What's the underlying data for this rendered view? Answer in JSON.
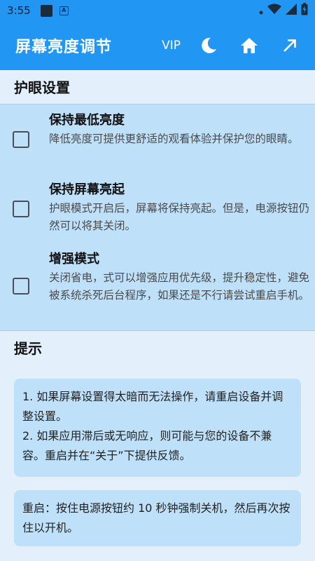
{
  "status_bar": {
    "time": "3:55",
    "notif_letter": "A"
  },
  "app_bar": {
    "title": "屏幕亮度调节",
    "vip_label": "VIP",
    "icons": [
      "moon-icon",
      "home-icon",
      "arrow-up-right-icon"
    ]
  },
  "eye_care": {
    "header": "护眼设置",
    "items": [
      {
        "title": "保持最低亮度",
        "description": "降低亮度可提供更舒适的观看体验并保护您的眼睛。",
        "checked": false
      },
      {
        "title": "保持屏幕亮起",
        "description": "护眼模式开启后，屏幕将保持亮起。但是，电源按钮仍然可以将其关闭。",
        "checked": false
      },
      {
        "title": "增强模式",
        "description": "关闭省电，式可以增强应用优先级，提升稳定性，避免被系统杀死后台程序，如果还是不行请尝试重启手机。",
        "checked": false
      }
    ]
  },
  "tips": {
    "header": "提示",
    "card1": "1. 如果屏幕设置得太暗而无法操作，请重启设备并调整设置。\n2. 如果应用滞后或无响应，则可能与您的设备不兼容。重启并在“关于”下提供反馈。",
    "card2": "重启：按住电源按钮约 10 秒钟强制关机，然后再次按住以开机。"
  },
  "colors": {
    "primary": "#2196f3",
    "background": "#e3f0fb",
    "card": "#bfe0f9"
  }
}
